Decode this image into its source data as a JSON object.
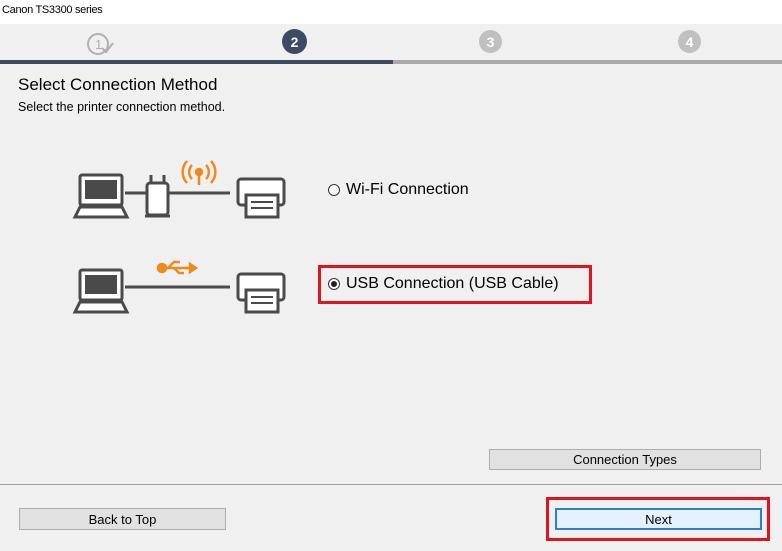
{
  "window": {
    "title": "Canon TS3300 series"
  },
  "steps": [
    {
      "label": "1",
      "state": "done"
    },
    {
      "label": "2",
      "state": "current"
    },
    {
      "label": "3",
      "state": "pending"
    },
    {
      "label": "4",
      "state": "pending"
    }
  ],
  "progress": {
    "current_step": 2,
    "total_steps": 4
  },
  "page": {
    "title": "Select Connection Method",
    "subtitle": "Select the printer connection method."
  },
  "options": [
    {
      "label": "Wi-Fi Connection",
      "selected": false,
      "icon": "wifi-icon"
    },
    {
      "label": "USB Connection (USB Cable)",
      "selected": true,
      "icon": "usb-icon"
    }
  ],
  "buttons": {
    "connection_types": "Connection Types",
    "back_to_top": "Back to Top",
    "next": "Next"
  },
  "colors": {
    "accent": "#3d4a63",
    "highlight": "#e0141e",
    "icon_orange": "#f08a1c",
    "icon_gray": "#4a4a4a"
  }
}
